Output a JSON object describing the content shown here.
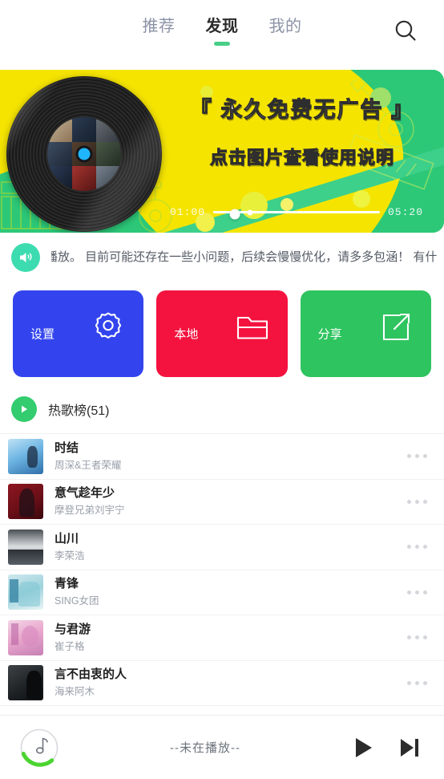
{
  "nav": {
    "tabs": [
      {
        "label": "推荐",
        "active": false
      },
      {
        "label": "发现",
        "active": true
      },
      {
        "label": "我的",
        "active": false
      }
    ],
    "search_icon": "search-icon"
  },
  "banner": {
    "title": "『 永久免费无广告 』",
    "subtitle": "点击图片查看使用说明",
    "current_time": "01:00",
    "total_time": "05:20",
    "progress_percent": 22,
    "bg_yellow": "#f5e400",
    "bg_green": "#2cc878",
    "vinyl_hole_color": "#1fb6ff"
  },
  "notice": {
    "icon": "speaker-icon",
    "icon_color": "#3ddcb0",
    "text": "线播放。 目前可能还存在一些小问题，后续会慢慢优化，请多多包涵！ 有什"
  },
  "cards": [
    {
      "label": "设置",
      "icon": "gear-icon",
      "color": "#3344ee",
      "name": "settings"
    },
    {
      "label": "本地",
      "icon": "folder-icon",
      "color": "#f4133f",
      "name": "local"
    },
    {
      "label": "分享",
      "icon": "share-icon",
      "color": "#2ec45f",
      "name": "share"
    }
  ],
  "section": {
    "play_icon": "play-icon",
    "title": "热歌榜(51)",
    "accent": "#33cc6f"
  },
  "songs": [
    {
      "title": "时结",
      "artist": "周深&王者荣耀",
      "art": "blue-portrait"
    },
    {
      "title": "意气趁年少",
      "artist": "摩登兄弟刘宇宁",
      "art": "red-portrait"
    },
    {
      "title": "山川",
      "artist": "李荣浩",
      "art": "gray-mountain"
    },
    {
      "title": "青锋",
      "artist": "SING女团",
      "art": "teal-group"
    },
    {
      "title": "与君游",
      "artist": "崔子格",
      "art": "pink-tree"
    },
    {
      "title": "言不由衷的人",
      "artist": "海来阿木",
      "art": "dark-portrait"
    }
  ],
  "player": {
    "avatar_icon": "music-note-icon",
    "status": "--未在播放--",
    "play_icon": "play-icon",
    "next_icon": "next-icon",
    "accent": "#4cd431"
  }
}
